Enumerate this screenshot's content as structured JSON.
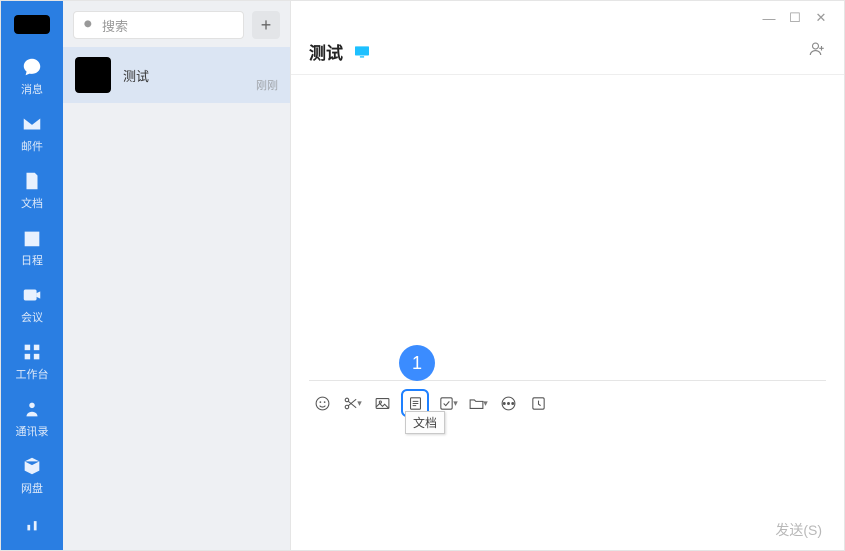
{
  "nav": {
    "items": [
      {
        "label": "消息"
      },
      {
        "label": "邮件"
      },
      {
        "label": "文档"
      },
      {
        "label": "日程"
      },
      {
        "label": "会议"
      },
      {
        "label": "工作台"
      },
      {
        "label": "通讯录"
      },
      {
        "label": "网盘"
      }
    ]
  },
  "search": {
    "placeholder": "搜索"
  },
  "conversation": {
    "title": "测试",
    "time": "刚刚"
  },
  "chat": {
    "title": "测试"
  },
  "window": {
    "min": "—",
    "max": "☐",
    "close": "✕"
  },
  "callout": {
    "num": "1"
  },
  "tooltip": {
    "text": "文档"
  },
  "send": {
    "label": "发送(S)"
  }
}
